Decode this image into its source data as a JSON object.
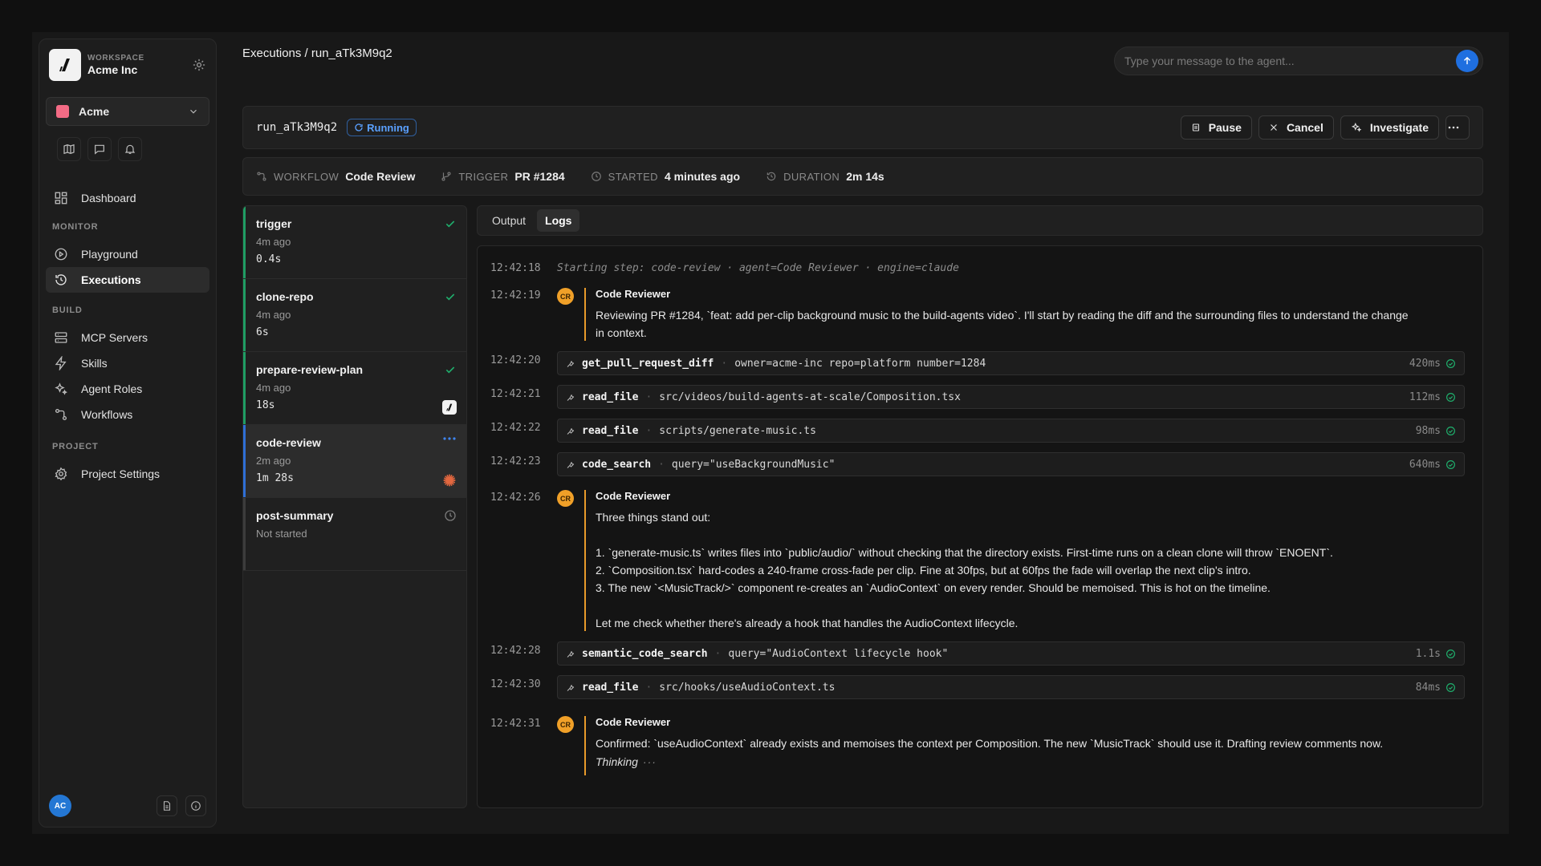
{
  "workspace": {
    "kicker": "WORKSPACE",
    "name": "Acme Inc",
    "org": "Acme",
    "user_initials": "AC"
  },
  "nav": {
    "dashboard": "Dashboard",
    "sections": {
      "monitor": "MONITOR",
      "build": "BUILD",
      "project": "PROJECT"
    },
    "monitor_items": [
      "Playground",
      "Executions"
    ],
    "build_items": [
      "MCP Servers",
      "Skills",
      "Agent Roles",
      "Workflows"
    ],
    "project_items": [
      "Project Settings"
    ]
  },
  "header": {
    "breadcrumb": "Executions / run_aTk3M9q2",
    "chat_placeholder": "Type your message to the agent..."
  },
  "run": {
    "id": "run_aTk3M9q2",
    "status": "Running",
    "actions": {
      "pause": "Pause",
      "cancel": "Cancel",
      "investigate": "Investigate"
    },
    "meta": {
      "workflow_key": "WORKFLOW",
      "workflow": "Code Review",
      "trigger_key": "TRIGGER",
      "trigger": "PR #1284",
      "started_key": "STARTED",
      "started": "4 minutes ago",
      "duration_key": "DURATION",
      "duration": "2m 14s"
    }
  },
  "steps": [
    {
      "name": "trigger",
      "ago": "4m ago",
      "duration": "0.4s",
      "status": "done"
    },
    {
      "name": "clone-repo",
      "ago": "4m ago",
      "duration": "6s",
      "status": "done"
    },
    {
      "name": "prepare-review-plan",
      "ago": "4m ago",
      "duration": "18s",
      "status": "done"
    },
    {
      "name": "code-review",
      "ago": "2m ago",
      "duration": "1m 28s",
      "status": "running"
    },
    {
      "name": "post-summary",
      "ago": "Not started",
      "duration": "",
      "status": "pending"
    }
  ],
  "tabs": [
    "Output",
    "Logs"
  ],
  "logs": {
    "system": {
      "time": "12:42:18",
      "text": "Starting step: code-review · agent=Code Reviewer · engine=claude"
    },
    "author": "Code Reviewer",
    "author_initials": "CR",
    "msg1": {
      "time": "12:42:19",
      "lines": [
        "Reviewing PR #1284, `feat: add per-clip background music to the build-agents video`. I'll start by reading the diff and the surrounding files to understand the change",
        "in context."
      ]
    },
    "tools1": [
      {
        "time": "12:42:20",
        "name": "get_pull_request_diff",
        "args": "owner=acme-inc repo=platform number=1284",
        "dur": "420ms"
      },
      {
        "time": "12:42:21",
        "name": "read_file",
        "args": "src/videos/build-agents-at-scale/Composition.tsx",
        "dur": "112ms"
      },
      {
        "time": "12:42:22",
        "name": "read_file",
        "args": "scripts/generate-music.ts",
        "dur": "98ms"
      },
      {
        "time": "12:42:23",
        "name": "code_search",
        "args": "query=\"useBackgroundMusic\"",
        "dur": "640ms"
      }
    ],
    "msg2": {
      "time": "12:42:26",
      "intro": "Three things stand out:",
      "points": [
        "1. `generate-music.ts` writes files into `public/audio/` without checking that the directory exists. First-time runs on a clean clone will throw `ENOENT`.",
        "2. `Composition.tsx` hard-codes a 240-frame cross-fade per clip. Fine at 30fps, but at 60fps the fade will overlap the next clip's intro.",
        "3. The new `<MusicTrack/>` component re-creates an `AudioContext` on every render. Should be memoised. This is hot on the timeline."
      ],
      "outro": "Let me check whether there's already a hook that handles the AudioContext lifecycle."
    },
    "tools2": [
      {
        "time": "12:42:28",
        "name": "semantic_code_search",
        "args": "query=\"AudioContext lifecycle hook\"",
        "dur": "1.1s"
      },
      {
        "time": "12:42:30",
        "name": "read_file",
        "args": "src/hooks/useAudioContext.ts",
        "dur": "84ms"
      }
    ],
    "msg3": {
      "time": "12:42:31",
      "text": "Confirmed: `useAudioContext` already exists and memoises the context per Composition. The new `MusicTrack` should use it. Drafting review comments now.",
      "thinking": "Thinking"
    }
  },
  "colors": {
    "accent": "#2f6fd6",
    "success": "#1f9d63",
    "agent": "#f0a028",
    "badge": "#5aa0ff"
  }
}
